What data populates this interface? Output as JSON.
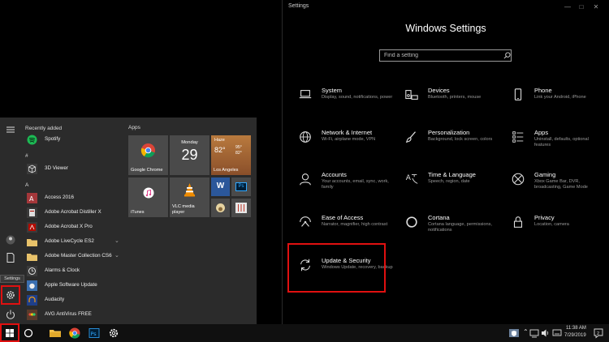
{
  "settings_window": {
    "title": "Settings",
    "heading": "Windows Settings",
    "search_placeholder": "Find a setting",
    "categories": [
      {
        "name": "System",
        "desc": "Display, sound, notifications, power",
        "icon": "laptop-icon"
      },
      {
        "name": "Devices",
        "desc": "Bluetooth, printers, mouse",
        "icon": "keyboard-speaker-icon"
      },
      {
        "name": "Phone",
        "desc": "Link your Android, iPhone",
        "icon": "phone-icon"
      },
      {
        "name": "Network & Internet",
        "desc": "Wi-Fi, airplane mode, VPN",
        "icon": "globe-icon"
      },
      {
        "name": "Personalization",
        "desc": "Background, lock screen, colors",
        "icon": "paintbrush-icon"
      },
      {
        "name": "Apps",
        "desc": "Uninstall, defaults, optional features",
        "icon": "apps-list-icon"
      },
      {
        "name": "Accounts",
        "desc": "Your accounts, email, sync, work, family",
        "icon": "person-icon"
      },
      {
        "name": "Time & Language",
        "desc": "Speech, region, date",
        "icon": "time-language-icon"
      },
      {
        "name": "Gaming",
        "desc": "Xbox Game Bar, DVR, broadcasting, Game Mode",
        "icon": "xbox-icon"
      },
      {
        "name": "Ease of Access",
        "desc": "Narrator, magnifier, high contrast",
        "icon": "ease-of-access-icon"
      },
      {
        "name": "Cortana",
        "desc": "Cortana language, permissions, notifications",
        "icon": "cortana-circle-icon"
      },
      {
        "name": "Privacy",
        "desc": "Location, camera",
        "icon": "lock-icon"
      },
      {
        "name": "Update & Security",
        "desc": "Windows Update, recovery, backup",
        "icon": "sync-arrows-icon"
      }
    ]
  },
  "start_menu": {
    "recently_added_label": "Recently added",
    "apps_header": "Apps",
    "settings_tooltip": "Settings",
    "sections": {
      "hash": "#",
      "a": "A"
    },
    "apps": [
      {
        "label": "Spotify",
        "color": "#1DB954",
        "chevron": false
      },
      {
        "label": "3D Viewer",
        "color": "#3a3a3a",
        "chevron": false
      },
      {
        "label": "Access 2016",
        "color": "#A4373A",
        "chevron": false
      },
      {
        "label": "Adobe Acrobat Distiller X",
        "color": "#3a3a3a",
        "chevron": false
      },
      {
        "label": "Adobe Acrobat X Pro",
        "color": "#B30B00",
        "chevron": false
      },
      {
        "label": "Adobe LiveCycle ES2",
        "color": "#E8C26A",
        "chevron": true
      },
      {
        "label": "Adobe Master Collection CS6",
        "color": "#E8C26A",
        "chevron": true
      },
      {
        "label": "Alarms & Clock",
        "color": "#3a3a3a",
        "chevron": false
      },
      {
        "label": "Apple Software Update",
        "color": "#3a6fb0",
        "chevron": false
      },
      {
        "label": "Audacity",
        "color": "#1e3f8a",
        "chevron": false
      },
      {
        "label": "AVG AntiVirus FREE",
        "color": "#5a3a2a",
        "chevron": false
      }
    ],
    "tiles": {
      "chrome_label": "Google Chrome",
      "calendar_day": "Monday",
      "calendar_date": "29",
      "weather_condition": "Haze",
      "weather_temp": "82°",
      "weather_high": "95°",
      "weather_low": "82°",
      "weather_city": "Los Angeles",
      "itunes_label": "iTunes",
      "vlc_label": "VLC media player",
      "word_letter": "W",
      "ps_letter": "Ps"
    }
  },
  "taskbar": {
    "time": "11:38 AM",
    "date": "7/29/2019",
    "notification_count": "2"
  }
}
